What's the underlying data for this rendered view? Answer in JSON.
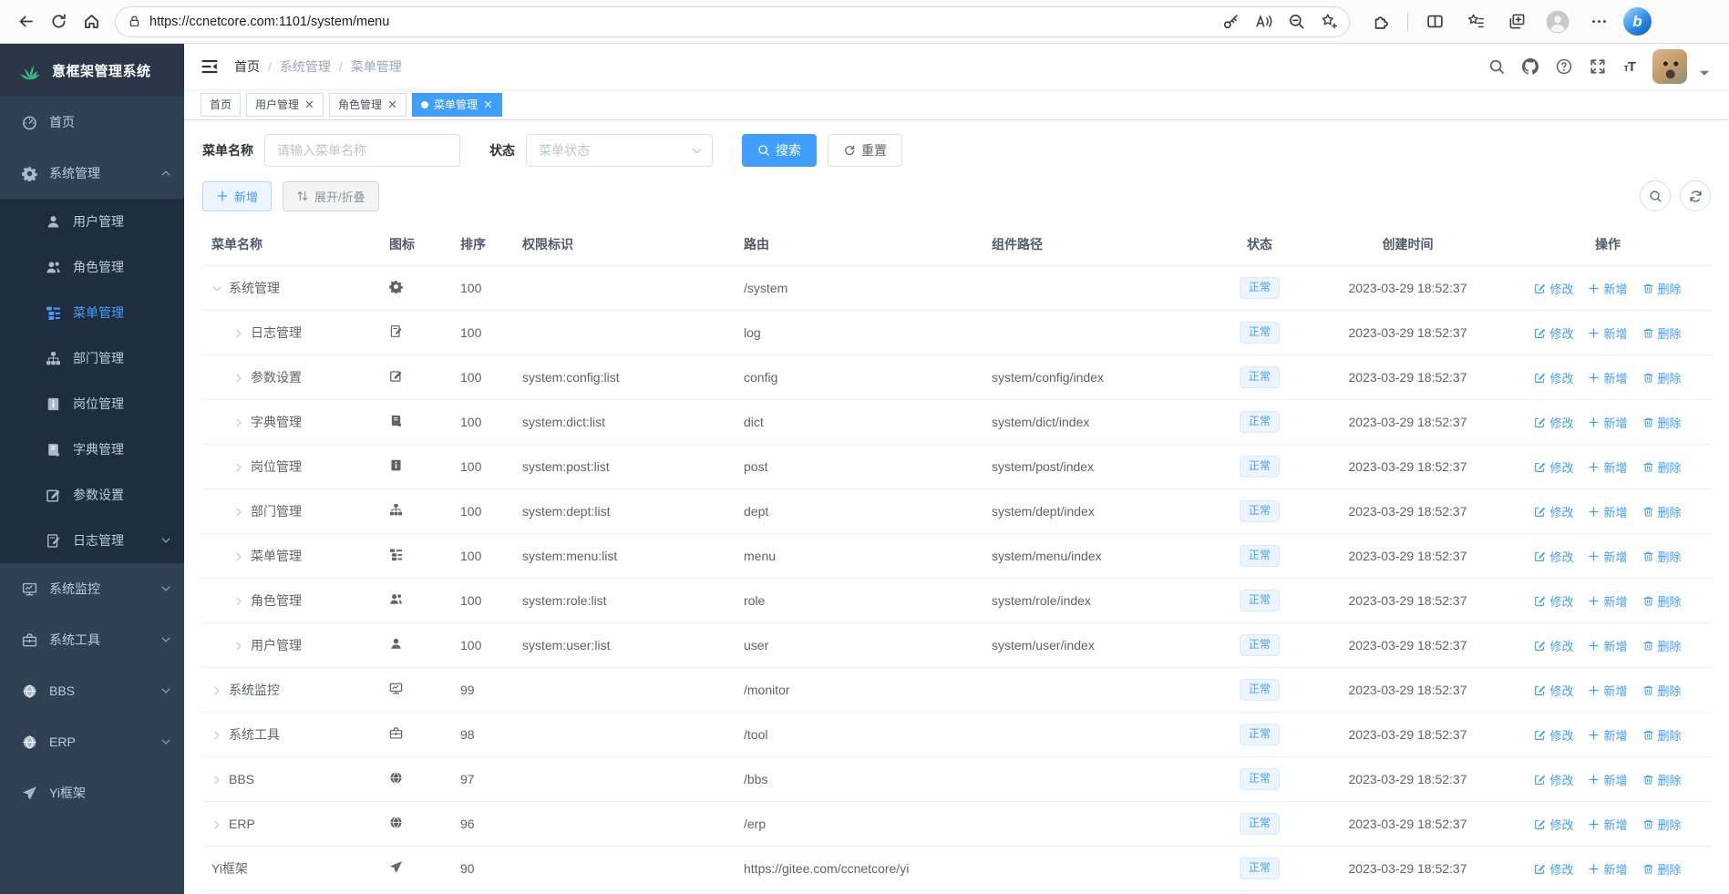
{
  "browser": {
    "url": "https://ccnetcore.com:1101/system/menu",
    "left_icons": [
      "back-icon",
      "refresh-icon",
      "home-icon"
    ],
    "pill_icons": [
      "key-icon",
      "read-aloud-icon",
      "zoom-out-icon",
      "favorite-add-icon"
    ],
    "right_icons": [
      "extensions-icon",
      "split-screen-icon",
      "favorites-bar-icon",
      "collections-icon",
      "profile-icon",
      "more-icon",
      "bing-icon"
    ],
    "bing_label": "b"
  },
  "sidebar": {
    "logo_text": "意框架管理系统",
    "items": [
      {
        "label": "首页",
        "icon": "dashboard-icon",
        "type": "top",
        "arrow": null,
        "active": false
      },
      {
        "label": "系统管理",
        "icon": "gear-icon",
        "type": "top",
        "arrow": "up",
        "active": false
      },
      {
        "label": "用户管理",
        "icon": "user-icon",
        "type": "sub",
        "arrow": null,
        "active": false
      },
      {
        "label": "角色管理",
        "icon": "peoples-icon",
        "type": "sub",
        "arrow": null,
        "active": false
      },
      {
        "label": "菜单管理",
        "icon": "menu-icon",
        "type": "sub",
        "arrow": null,
        "active": true
      },
      {
        "label": "部门管理",
        "icon": "tree-icon",
        "type": "sub",
        "arrow": null,
        "active": false
      },
      {
        "label": "岗位管理",
        "icon": "post-icon",
        "type": "sub",
        "arrow": null,
        "active": false
      },
      {
        "label": "字典管理",
        "icon": "dict-icon",
        "type": "sub",
        "arrow": null,
        "active": false
      },
      {
        "label": "参数设置",
        "icon": "edit-icon",
        "type": "sub",
        "arrow": null,
        "active": false
      },
      {
        "label": "日志管理",
        "icon": "log-icon",
        "type": "sub",
        "arrow": "down",
        "active": false
      },
      {
        "label": "系统监控",
        "icon": "monitor-icon",
        "type": "top",
        "arrow": "down",
        "active": false
      },
      {
        "label": "系统工具",
        "icon": "tool-icon",
        "type": "top",
        "arrow": "down",
        "active": false
      },
      {
        "label": "BBS",
        "icon": "globe-icon",
        "type": "top",
        "arrow": "down",
        "active": false
      },
      {
        "label": "ERP",
        "icon": "globe-icon",
        "type": "top",
        "arrow": "down",
        "active": false
      },
      {
        "label": "Yi框架",
        "icon": "plane-icon",
        "type": "top",
        "arrow": null,
        "active": false
      }
    ]
  },
  "header": {
    "breadcrumb": [
      "首页",
      "系统管理",
      "菜单管理"
    ],
    "right_icons": [
      "search-icon",
      "github-icon",
      "help-icon",
      "fullscreen-icon",
      "font-size-icon"
    ]
  },
  "tags": [
    {
      "label": "首页",
      "closable": false,
      "active": false
    },
    {
      "label": "用户管理",
      "closable": true,
      "active": false
    },
    {
      "label": "角色管理",
      "closable": true,
      "active": false
    },
    {
      "label": "菜单管理",
      "closable": true,
      "active": true
    }
  ],
  "search": {
    "name_label": "菜单名称",
    "name_placeholder": "请输入菜单名称",
    "status_label": "状态",
    "status_placeholder": "菜单状态",
    "search_button": "搜索",
    "reset_button": "重置"
  },
  "toolbar": {
    "add_button": "新增",
    "expand_button": "展开/折叠"
  },
  "table": {
    "columns": [
      "菜单名称",
      "图标",
      "排序",
      "权限标识",
      "路由",
      "组件路径",
      "状态",
      "创建时间",
      "操作"
    ],
    "status_normal": "正常",
    "ops": {
      "edit": "修改",
      "add": "新增",
      "delete": "删除"
    },
    "rows": [
      {
        "name": "系统管理",
        "icon": "gear-icon",
        "arrow": "expanded",
        "level": 0,
        "order": "100",
        "perms": "",
        "route": "/system",
        "component": "",
        "created": "2023-03-29 18:52:37"
      },
      {
        "name": "日志管理",
        "icon": "log-icon",
        "arrow": "collapsed",
        "level": 1,
        "order": "100",
        "perms": "",
        "route": "log",
        "component": "",
        "created": "2023-03-29 18:52:37"
      },
      {
        "name": "参数设置",
        "icon": "edit-icon",
        "arrow": "collapsed",
        "level": 1,
        "order": "100",
        "perms": "system:config:list",
        "route": "config",
        "component": "system/config/index",
        "created": "2023-03-29 18:52:37"
      },
      {
        "name": "字典管理",
        "icon": "dict-icon",
        "arrow": "collapsed",
        "level": 1,
        "order": "100",
        "perms": "system:dict:list",
        "route": "dict",
        "component": "system/dict/index",
        "created": "2023-03-29 18:52:37"
      },
      {
        "name": "岗位管理",
        "icon": "post-icon",
        "arrow": "collapsed",
        "level": 1,
        "order": "100",
        "perms": "system:post:list",
        "route": "post",
        "component": "system/post/index",
        "created": "2023-03-29 18:52:37"
      },
      {
        "name": "部门管理",
        "icon": "tree-icon",
        "arrow": "collapsed",
        "level": 1,
        "order": "100",
        "perms": "system:dept:list",
        "route": "dept",
        "component": "system/dept/index",
        "created": "2023-03-29 18:52:37"
      },
      {
        "name": "菜单管理",
        "icon": "menu-icon",
        "arrow": "collapsed",
        "level": 1,
        "order": "100",
        "perms": "system:menu:list",
        "route": "menu",
        "component": "system/menu/index",
        "created": "2023-03-29 18:52:37"
      },
      {
        "name": "角色管理",
        "icon": "peoples-icon",
        "arrow": "collapsed",
        "level": 1,
        "order": "100",
        "perms": "system:role:list",
        "route": "role",
        "component": "system/role/index",
        "created": "2023-03-29 18:52:37"
      },
      {
        "name": "用户管理",
        "icon": "user-icon",
        "arrow": "collapsed",
        "level": 1,
        "order": "100",
        "perms": "system:user:list",
        "route": "user",
        "component": "system/user/index",
        "created": "2023-03-29 18:52:37"
      },
      {
        "name": "系统监控",
        "icon": "monitor-icon",
        "arrow": "collapsed",
        "level": 0,
        "order": "99",
        "perms": "",
        "route": "/monitor",
        "component": "",
        "created": "2023-03-29 18:52:37"
      },
      {
        "name": "系统工具",
        "icon": "tool-icon",
        "arrow": "collapsed",
        "level": 0,
        "order": "98",
        "perms": "",
        "route": "/tool",
        "component": "",
        "created": "2023-03-29 18:52:37"
      },
      {
        "name": "BBS",
        "icon": "globe-icon",
        "arrow": "collapsed",
        "level": 0,
        "order": "97",
        "perms": "",
        "route": "/bbs",
        "component": "",
        "created": "2023-03-29 18:52:37"
      },
      {
        "name": "ERP",
        "icon": "globe-icon",
        "arrow": "collapsed",
        "level": 0,
        "order": "96",
        "perms": "",
        "route": "/erp",
        "component": "",
        "created": "2023-03-29 18:52:37"
      },
      {
        "name": "Yi框架",
        "icon": "plane-icon",
        "arrow": null,
        "level": 0,
        "order": "90",
        "perms": "",
        "route": "https://gitee.com/ccnetcore/yi",
        "component": "",
        "created": "2023-03-29 18:52:37"
      }
    ]
  },
  "colors": {
    "primary": "#409eff",
    "sidebar_bg": "#304156",
    "submenu_bg": "#1f2d3d",
    "logo_bg": "#2b3648",
    "logo_green": "#3cb57f",
    "status_tag_bg": "#ecf5ff",
    "status_tag_border": "#d9ecff",
    "active_tag_bg": "#409eff"
  }
}
